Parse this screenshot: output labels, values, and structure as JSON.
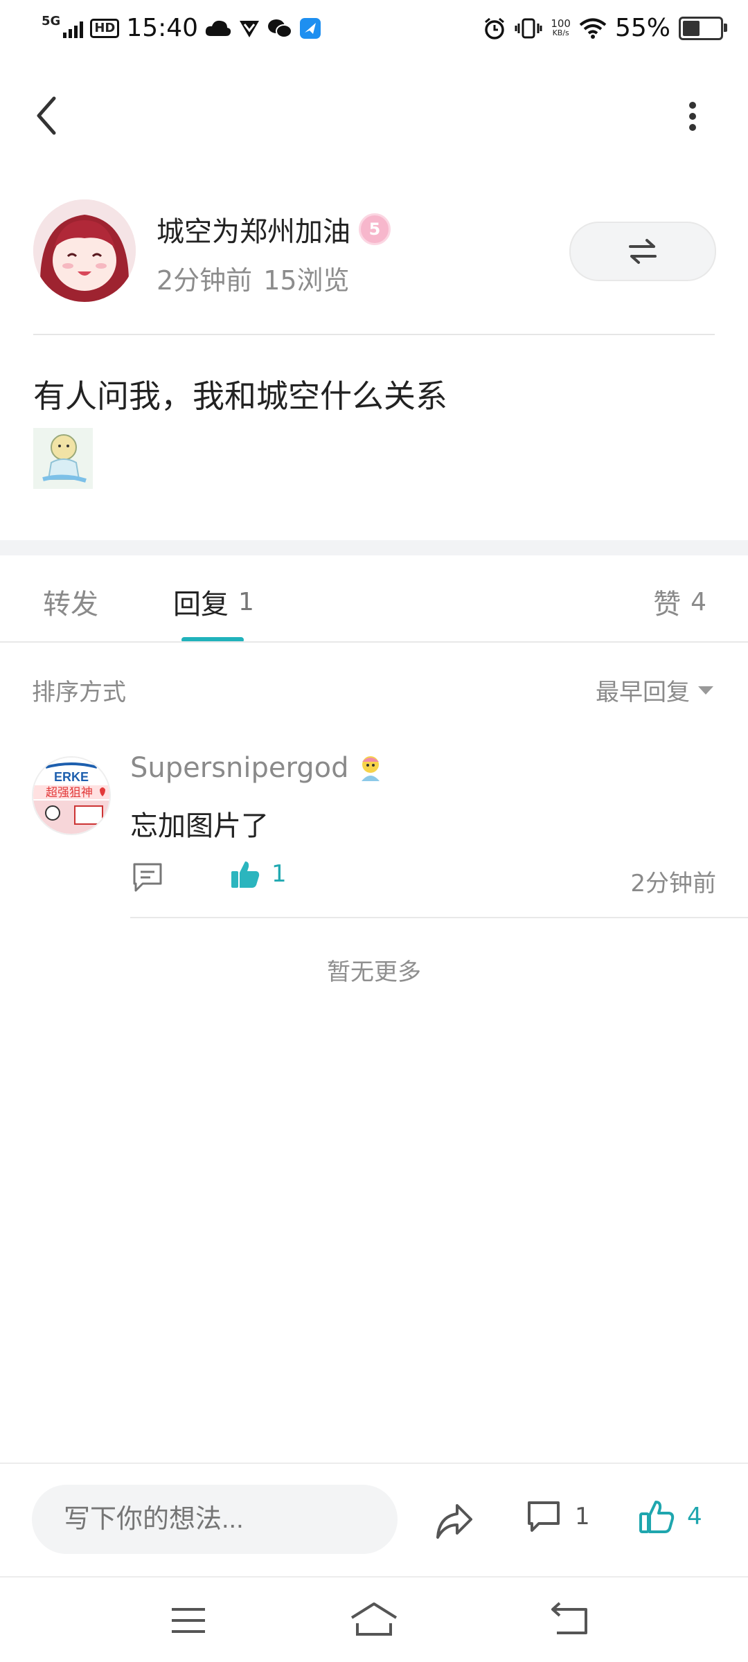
{
  "status_bar": {
    "network": "5G",
    "hd": "HD",
    "time": "15:40",
    "net_speed_value": "100",
    "net_speed_unit": "KB/s",
    "battery": "55%"
  },
  "post": {
    "author": "城空为郑州加油",
    "level_badge": "5",
    "time_ago": "2分钟前",
    "views": "15浏览",
    "text": "有人问我，我和城空什么关系"
  },
  "tabs": {
    "repost": "转发",
    "reply": "回复",
    "reply_count": "1",
    "likes": "赞",
    "likes_count": "4"
  },
  "sort": {
    "label": "排序方式",
    "selected": "最早回复"
  },
  "comments": [
    {
      "user": "Supersnipergod",
      "avatar_brand": "ERKE",
      "avatar_caption": "超强狙神",
      "text": "忘加图片了",
      "likes": "1",
      "time": "2分钟前"
    }
  ],
  "no_more": "暂无更多",
  "bottom_bar": {
    "input_placeholder": "写下你的想法...",
    "comment_count": "1",
    "like_count": "4"
  },
  "colors": {
    "accent": "#21b2bb",
    "divider": "#e8e8e8",
    "muted_text": "#8a8a8a"
  }
}
